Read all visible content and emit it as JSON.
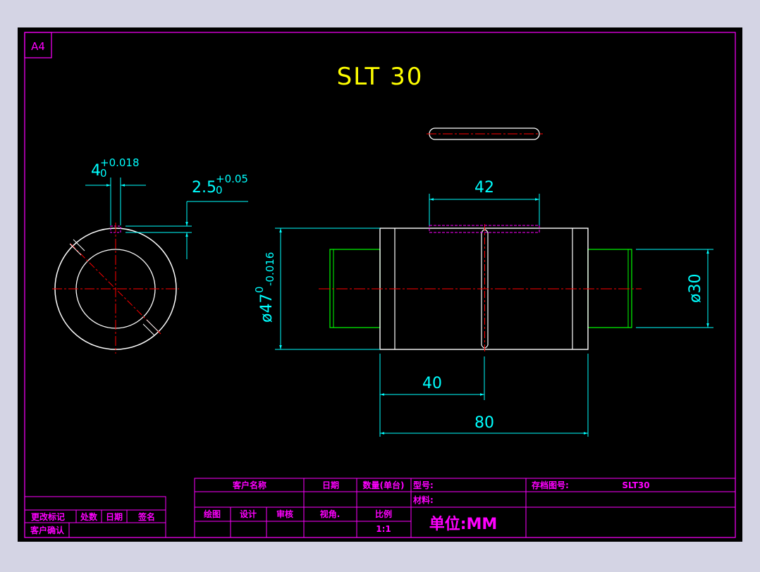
{
  "drawing": {
    "sheet_size": "A4",
    "title": "SLT 30"
  },
  "dimensions": {
    "key_width": "4",
    "key_width_upper": "+0.018",
    "key_width_lower": "0",
    "key_depth": "2.5",
    "key_depth_upper": "+0.05",
    "key_depth_lower": "0",
    "slot_length": "42",
    "outer_diameter_prefix": "ø47",
    "outer_diameter_upper": "0",
    "outer_diameter_lower": "-0.016",
    "inner_diameter": "ø30",
    "half_length": "40",
    "total_length": "80"
  },
  "title_block": {
    "customer_name_label": "客户名称",
    "date_label": "日期",
    "quantity_label": "数量(单台)",
    "model_label": "型号:",
    "archive_no_label": "存档图号:",
    "archive_no_value": "SLT30",
    "material_label": "材料:",
    "drawn_label": "绘图",
    "design_label": "设计",
    "review_label": "审核",
    "view_label": "视角.",
    "scale_label": "比例",
    "scale_value": "1:1",
    "unit_text": "单位:MM",
    "revision_label": "更改标记",
    "count_label": "处数",
    "date2_label": "日期",
    "sign_label": "签名",
    "customer_confirm_label": "客户确认"
  },
  "colors": {
    "background": "#000000",
    "frame": "#ff00ff",
    "dimension": "#00ffff",
    "title": "#ffff00",
    "part": "#ffffff",
    "centerline": "#ff0000",
    "shaft": "#00ff00"
  }
}
